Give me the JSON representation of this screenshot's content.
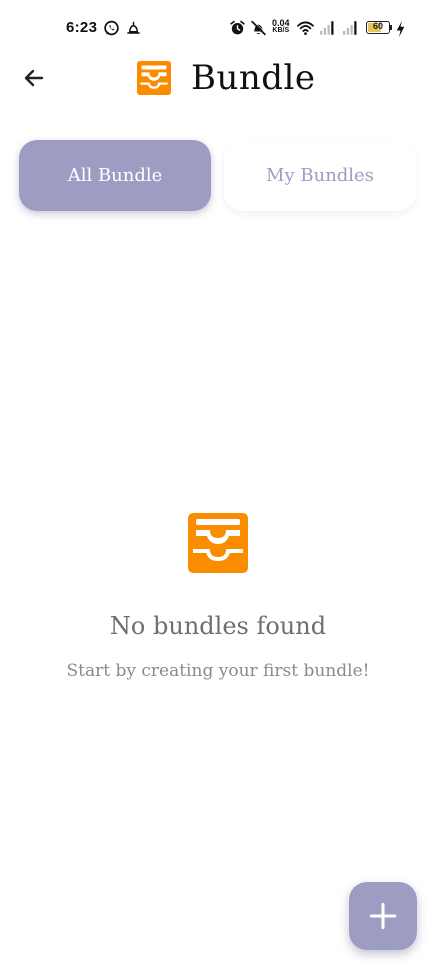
{
  "status_bar": {
    "time": "6:23",
    "net_speed_value": "0.04",
    "net_speed_unit": "KB/S",
    "battery_level": "60",
    "icons": [
      "whatsapp-icon",
      "notification-icon",
      "alarm-icon",
      "mute-icon",
      "wifi-icon",
      "signal-icon",
      "signal-icon",
      "battery-icon",
      "charging-icon"
    ]
  },
  "header": {
    "title": "Bundle",
    "logo_icon": "bundle-tray-icon",
    "back_icon": "arrow-left-icon"
  },
  "tabs": [
    {
      "label": "All Bundle",
      "active": true
    },
    {
      "label": "My Bundles",
      "active": false
    }
  ],
  "empty_state": {
    "icon": "bundle-tray-icon",
    "title": "No bundles found",
    "subtitle": "Start by creating your first bundle!"
  },
  "fab": {
    "icon": "plus-icon"
  },
  "colors": {
    "accent": "#9d9dc4",
    "brand_orange": "#fb8c00",
    "text_muted": "#6f6f6f"
  }
}
